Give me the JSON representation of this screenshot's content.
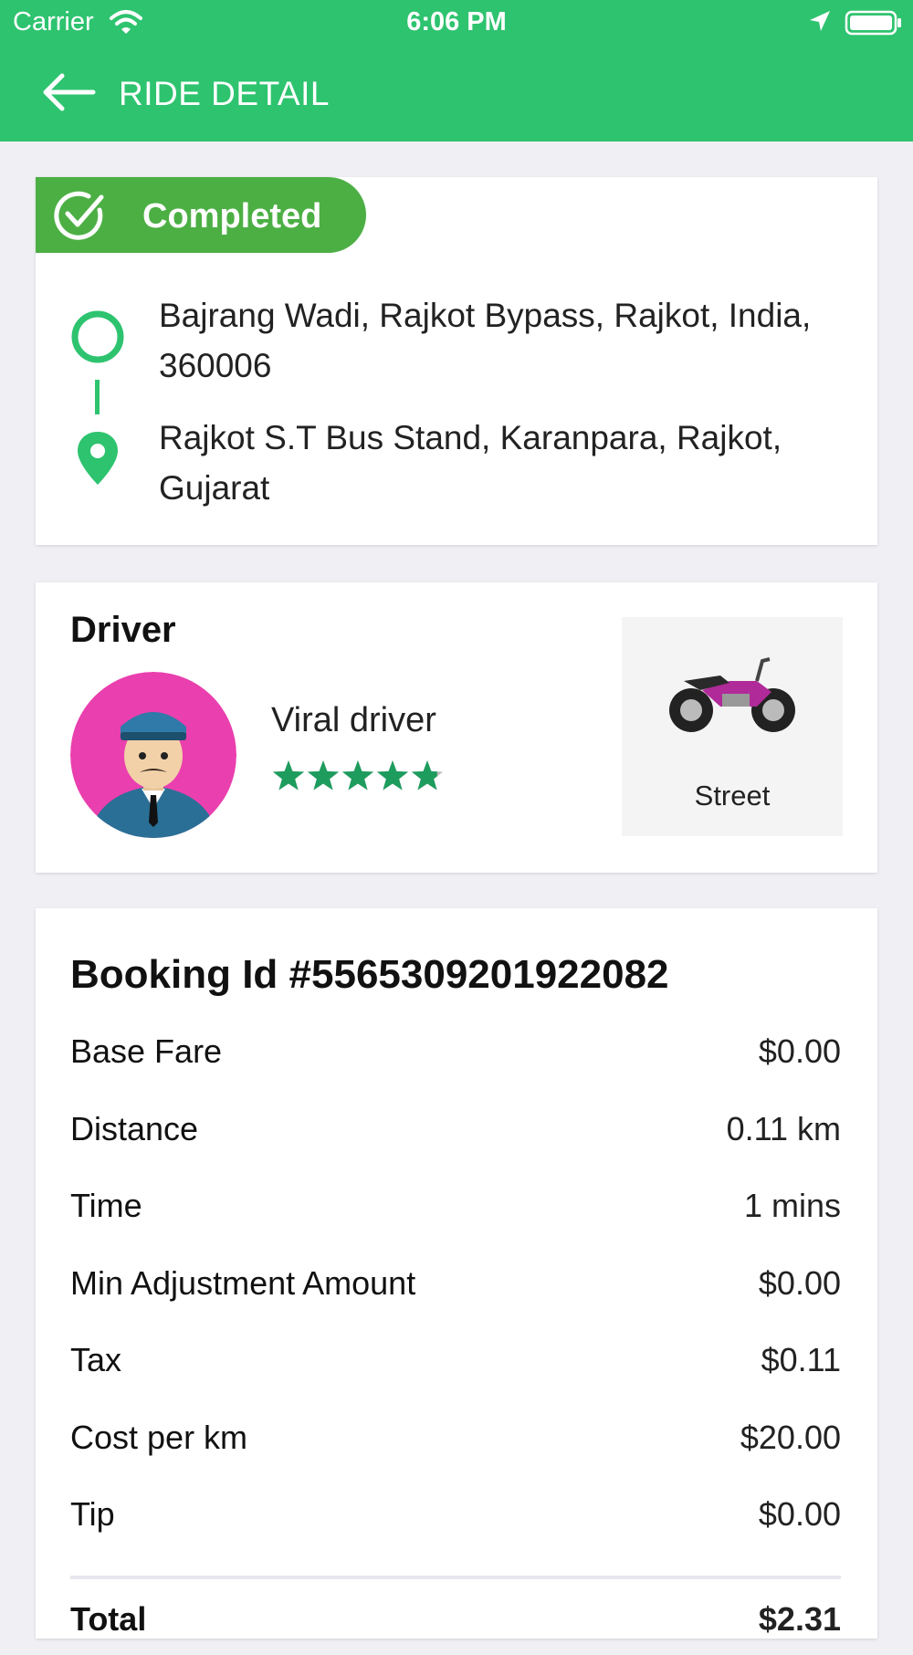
{
  "status_bar": {
    "carrier": "Carrier",
    "time": "6:06 PM"
  },
  "header": {
    "title": "RIDE DETAIL"
  },
  "ride": {
    "status": "Completed",
    "pickup_address": "Bajrang Wadi, Rajkot Bypass, Rajkot, India, 360006",
    "dropoff_address": "Rajkot S.T Bus Stand, Karanpara, Rajkot, Gujarat"
  },
  "driver": {
    "heading": "Driver",
    "name": "Viral driver",
    "rating": 4.8,
    "vehicle_type": "Street"
  },
  "fare": {
    "booking_id": "Booking Id #5565309201922082",
    "rows": [
      {
        "label": "Base Fare",
        "value": "$0.00"
      },
      {
        "label": "Distance",
        "value": "0.11 km"
      },
      {
        "label": "Time",
        "value": "1 mins"
      },
      {
        "label": "Min Adjustment Amount",
        "value": "$0.00"
      },
      {
        "label": "Tax",
        "value": "$0.11"
      },
      {
        "label": "Cost per km",
        "value": "$20.00"
      },
      {
        "label": "Tip",
        "value": "$0.00"
      }
    ],
    "total": {
      "label": "Total",
      "value": "$2.31"
    }
  },
  "colors": {
    "accent": "#2ec36f",
    "badge": "#4caf44",
    "star": "#1e9c5e"
  },
  "icons": [
    "wifi-icon",
    "location-arrow-icon",
    "battery-icon",
    "back-arrow-icon",
    "check-circle-icon",
    "pickup-circle-icon",
    "map-pin-icon",
    "driver-avatar",
    "star-icon",
    "motorcycle-icon"
  ]
}
